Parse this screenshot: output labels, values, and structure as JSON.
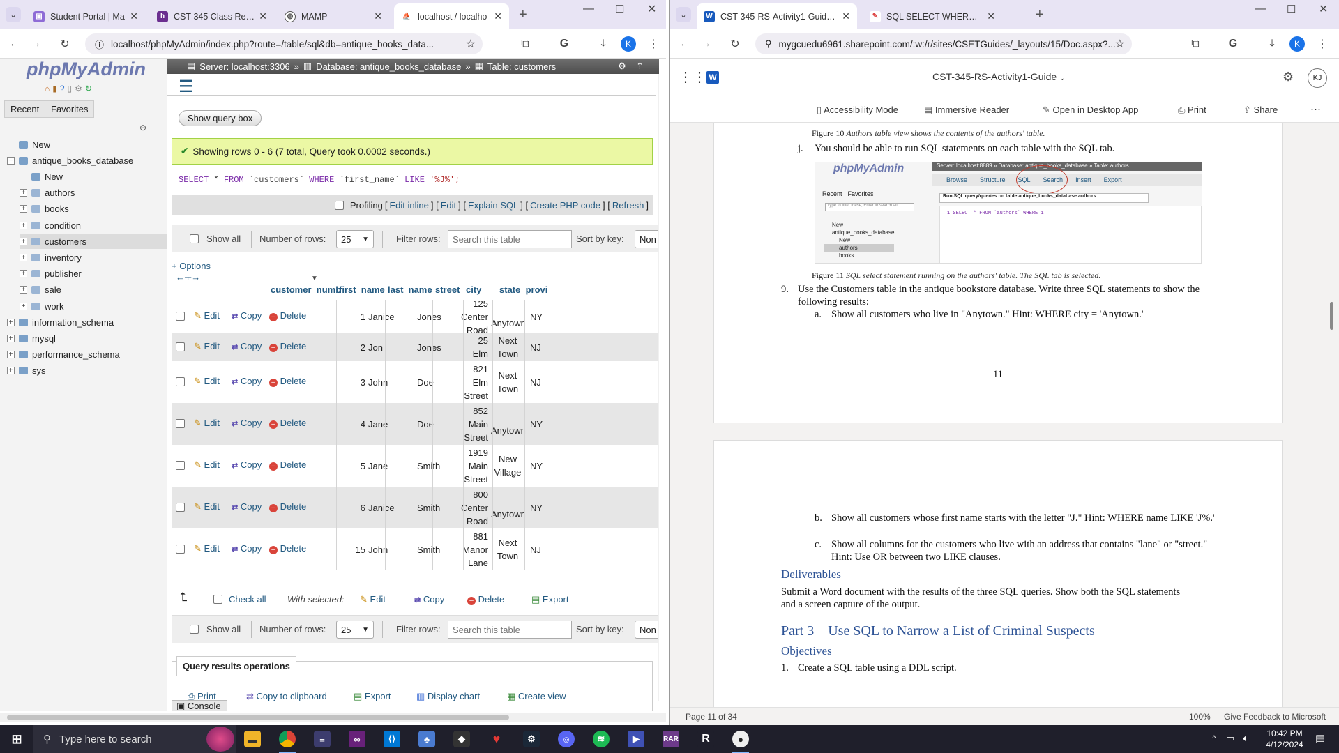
{
  "left_browser": {
    "tabs": [
      {
        "title": "Student Portal | Ma",
        "active": false
      },
      {
        "title": "CST-345 Class Reso",
        "active": false
      },
      {
        "title": "MAMP",
        "active": false
      },
      {
        "title": "localhost / localho",
        "active": true
      }
    ],
    "url": "localhost/phpMyAdmin/index.php?route=/table/sql&db=antique_books_data...",
    "profile_initial": "K"
  },
  "pma": {
    "logo_text": "phpMyAdmin",
    "nav_tabs": [
      "Recent",
      "Favorites"
    ],
    "tree": [
      {
        "label": "New",
        "level": 0
      },
      {
        "label": "antique_books_database",
        "level": 0
      },
      {
        "label": "New",
        "level": 1
      },
      {
        "label": "authors",
        "level": 1
      },
      {
        "label": "books",
        "level": 1
      },
      {
        "label": "condition",
        "level": 1
      },
      {
        "label": "customers",
        "level": 1
      },
      {
        "label": "inventory",
        "level": 1
      },
      {
        "label": "publisher",
        "level": 1
      },
      {
        "label": "sale",
        "level": 1
      },
      {
        "label": "work",
        "level": 1
      },
      {
        "label": "information_schema",
        "level": 0
      },
      {
        "label": "mysql",
        "level": 0
      },
      {
        "label": "performance_schema",
        "level": 0
      },
      {
        "label": "sys",
        "level": 0
      }
    ],
    "breadcrumb": {
      "server": "Server: localhost:3306",
      "database": "Database: antique_books_database",
      "table": "Table: customers"
    },
    "show_query_box": "Show query box",
    "success_message": "Showing rows 0 - 6 (7 total, Query took 0.0002 seconds.)",
    "sql": {
      "select": "SELECT",
      "star": " * ",
      "from": "FROM",
      "table": " `customers` ",
      "where": "WHERE",
      "field": " `first_name` ",
      "like": "LIKE",
      "pattern": " '%J%';"
    },
    "profiling": {
      "label": "Profiling",
      "links": [
        "Edit inline",
        "Edit",
        "Explain SQL",
        "Create PHP code",
        "Refresh"
      ]
    },
    "filter_bar": {
      "show_all": "Show all",
      "number_of_rows_label": "Number of rows:",
      "rows_value": "25",
      "filter_label": "Filter rows:",
      "filter_placeholder": "Search this table",
      "sort_label": "Sort by key:",
      "sort_value": "Non"
    },
    "options_link": "+ Options",
    "columns": [
      "customer_numb",
      "first_name",
      "last_name",
      "street",
      "city",
      "state_provi"
    ],
    "action_labels": {
      "edit": "Edit",
      "copy": "Copy",
      "delete": "Delete"
    },
    "rows": [
      {
        "id": "1",
        "first": "Janice",
        "last": "Jones",
        "street": [
          "125",
          "Center",
          "Road"
        ],
        "city": [
          "Anytown"
        ],
        "state": "NY"
      },
      {
        "id": "2",
        "first": "Jon",
        "last": "Jones",
        "street": [
          "25 Elm",
          "Road"
        ],
        "city": [
          "Next",
          "Town"
        ],
        "state": "NJ"
      },
      {
        "id": "3",
        "first": "John",
        "last": "Doe",
        "street": [
          "821",
          "Elm",
          "Street"
        ],
        "city": [
          "Next",
          "Town"
        ],
        "state": "NJ"
      },
      {
        "id": "4",
        "first": "Jane",
        "last": "Doe",
        "street": [
          "852",
          "Main",
          "Street"
        ],
        "city": [
          "Anytown"
        ],
        "state": "NY"
      },
      {
        "id": "5",
        "first": "Jane",
        "last": "Smith",
        "street": [
          "1919",
          "Main",
          "Street"
        ],
        "city": [
          "New",
          "Village"
        ],
        "state": "NY"
      },
      {
        "id": "6",
        "first": "Janice",
        "last": "Smith",
        "street": [
          "800",
          "Center",
          "Road"
        ],
        "city": [
          "Anytown"
        ],
        "state": "NY"
      },
      {
        "id": "15",
        "first": "John",
        "last": "Smith",
        "street": [
          "881",
          "Manor",
          "Lane"
        ],
        "city": [
          "Next",
          "Town"
        ],
        "state": "NJ"
      }
    ],
    "bulk": {
      "check_all": "Check all",
      "with_selected": "With selected:",
      "edit": "Edit",
      "copy": "Copy",
      "delete": "Delete",
      "export": "Export"
    },
    "query_results_ops": {
      "title": "Query results operations",
      "links": [
        "Print",
        "Copy to clipboard",
        "Export",
        "Display chart",
        "Create view"
      ]
    },
    "console": "Console"
  },
  "right_browser": {
    "tabs": [
      {
        "title": "CST-345-RS-Activity1-Guide.dc",
        "active": true
      },
      {
        "title": "SQL SELECT WHERE field conta",
        "active": false
      }
    ],
    "url": "mygcuedu6961.sharepoint.com/:w:/r/sites/CSETGuides/_layouts/15/Doc.aspx?...",
    "profile_initial": "K"
  },
  "word": {
    "doc_title": "CST-345-RS-Activity1-Guide",
    "user_initials": "KJ",
    "ribbon": [
      "Accessibility Mode",
      "Immersive Reader",
      "Open in Desktop App",
      "Print",
      "Share"
    ],
    "fig10_prefix": "Figure 10 ",
    "fig10_caption": "Authors table view shows the contents of the authors' table.",
    "item_j_marker": "j.",
    "item_j": "You should be able to run SQL statements on each table with the SQL tab.",
    "fig11_prefix": "Figure 11 ",
    "fig11_caption": "SQL select statement running on the authors' table. The SQL tab is selected.",
    "embedded": {
      "logo": "phpMyAdmin",
      "crumb": "Server: localhost:8889 » Database: antique_books_database » Table: authors",
      "tabs": [
        "Browse",
        "Structure",
        "SQL",
        "Search",
        "Insert",
        "Export"
      ],
      "nav": [
        "Recent",
        "Favorites"
      ],
      "filter": "Type to filter these, Enter to search all",
      "run_sql_label": "Run SQL query/queries on table antique_books_database.authors:",
      "query": "1  SELECT * FROM `authors` WHERE 1",
      "tree": [
        "New",
        "antique_books_database",
        "New",
        "authors",
        "books"
      ]
    },
    "item9_marker": "9.",
    "item9": "Use the Customers table in the antique bookstore database. Write three SQL statements to show the following results:",
    "item_a_marker": "a.",
    "item_a": "Show all customers who live in \"Anytown.\" Hint: WHERE city = 'Anytown.'",
    "page_number": "11",
    "item_b_marker": "b.",
    "item_b": "Show all customers whose first name starts with the letter \"J.\" Hint: WHERE name LIKE 'J%.'",
    "item_c_marker": "c.",
    "item_c": "Show all columns for the customers who live with an address that contains \"lane\" or \"street.\" Hint: Use OR between two LIKE clauses.",
    "deliverables_heading": "Deliverables",
    "deliverables_text": "Submit a Word document with the results of the three SQL queries.  Show both the SQL statements and a screen capture of the output.",
    "part3_heading": "Part 3 – Use SQL to Narrow a List of Criminal Suspects",
    "objectives_heading": "Objectives",
    "obj1_marker": "1.",
    "obj1": "Create a SQL table using a DDL script.",
    "status_page": "Page 11 of 34",
    "status_zoom": "100%",
    "status_feedback": "Give Feedback to Microsoft"
  },
  "taskbar": {
    "search_placeholder": "Type here to search",
    "time": "10:42 PM",
    "date": "4/12/2024"
  },
  "colors": {
    "chrome_tabstrip": "#e8e4f4",
    "pma_success": "#ebf8a4",
    "pma_link": "#235a81",
    "word_heading": "#2f5496",
    "taskbar": "#1f1f2b"
  }
}
